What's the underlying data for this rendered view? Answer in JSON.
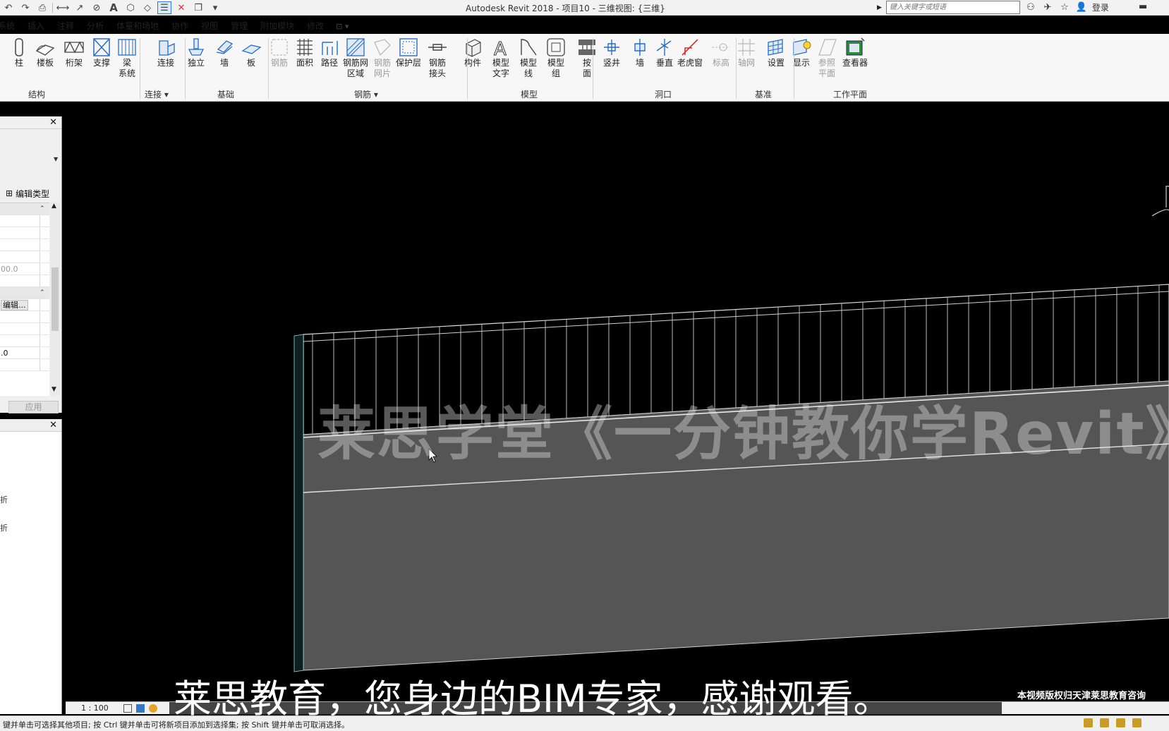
{
  "window": {
    "title": "Autodesk Revit 2018 -     项目10 - 三维视图: {三维}",
    "search_placeholder": "键入关键字或短语",
    "login_label": "登录",
    "minimize_label": "▬"
  },
  "tabs": [
    "系统",
    "插入",
    "注释",
    "分析",
    "体量和场地",
    "协作",
    "视图",
    "管理",
    "附加模块",
    "修改"
  ],
  "tab_extra": "⊡ ▾",
  "ribbon": {
    "tools": [
      {
        "id": "column",
        "label": "柱",
        "dim": false,
        "icon": "column-icon"
      },
      {
        "id": "floor",
        "label": "楼板",
        "dim": false,
        "icon": "floor-icon"
      },
      {
        "id": "truss",
        "label": "桁架",
        "dim": false,
        "icon": "truss-icon"
      },
      {
        "id": "brace",
        "label": "支撑",
        "dim": false,
        "icon": "brace-icon"
      },
      {
        "id": "beam-system",
        "label": "梁\n系统",
        "dim": false,
        "icon": "beam-system-icon"
      },
      {
        "id": "connection",
        "label": "连接",
        "dim": false,
        "icon": "connection-icon"
      },
      {
        "id": "isolated",
        "label": "独立",
        "dim": false,
        "icon": "isolated-foundation-icon"
      },
      {
        "id": "wall-foundation",
        "label": "墙",
        "dim": false,
        "icon": "wall-foundation-icon"
      },
      {
        "id": "slab",
        "label": "板",
        "dim": false,
        "icon": "slab-icon"
      },
      {
        "id": "rebar",
        "label": "钢筋",
        "dim": true,
        "icon": "rebar-icon"
      },
      {
        "id": "area",
        "label": "面积",
        "dim": false,
        "icon": "area-rebar-icon"
      },
      {
        "id": "path",
        "label": "路径",
        "dim": false,
        "icon": "path-rebar-icon"
      },
      {
        "id": "fabric-area",
        "label": "钢筋网\n区域",
        "dim": false,
        "icon": "fabric-area-icon"
      },
      {
        "id": "fabric-sheet",
        "label": "钢筋\n网片",
        "dim": true,
        "icon": "fabric-sheet-icon"
      },
      {
        "id": "cover",
        "label": "保护层",
        "dim": false,
        "icon": "cover-icon"
      },
      {
        "id": "coupler",
        "label": "钢筋\n接头",
        "dim": false,
        "icon": "coupler-icon"
      },
      {
        "id": "component",
        "label": "构件",
        "dim": false,
        "icon": "component-icon"
      },
      {
        "id": "model-text",
        "label": "模型\n文字",
        "dim": false,
        "icon": "model-text-icon"
      },
      {
        "id": "model-line",
        "label": "模型\n线",
        "dim": false,
        "icon": "model-line-icon"
      },
      {
        "id": "model-group",
        "label": "模型\n组",
        "dim": false,
        "icon": "model-group-icon"
      },
      {
        "id": "by-face",
        "label": "按\n面",
        "dim": false,
        "icon": "by-face-icon"
      },
      {
        "id": "shaft",
        "label": "竖井",
        "dim": false,
        "icon": "shaft-icon"
      },
      {
        "id": "wall-opening",
        "label": "墙",
        "dim": false,
        "icon": "wall-opening-icon"
      },
      {
        "id": "vertical",
        "label": "垂直",
        "dim": false,
        "icon": "vertical-opening-icon"
      },
      {
        "id": "dormer",
        "label": "老虎窗",
        "dim": false,
        "icon": "dormer-icon"
      },
      {
        "id": "level",
        "label": "标高",
        "dim": true,
        "icon": "level-icon"
      },
      {
        "id": "grid",
        "label": "轴网",
        "dim": true,
        "icon": "grid-icon"
      },
      {
        "id": "set",
        "label": "设置",
        "dim": false,
        "icon": "workplane-set-icon"
      },
      {
        "id": "show",
        "label": "显示",
        "dim": false,
        "icon": "workplane-show-icon"
      },
      {
        "id": "ref-plane",
        "label": "参照\n平面",
        "dim": true,
        "icon": "ref-plane-icon"
      },
      {
        "id": "viewer",
        "label": "查看器",
        "dim": false,
        "icon": "viewer-icon"
      }
    ],
    "panels": [
      "结构",
      "连接 ▾",
      "基础",
      "钢筋 ▾",
      "模型",
      "洞口",
      "基准",
      "工作平面"
    ]
  },
  "properties": {
    "edit_type_label": "编辑类型",
    "value_row": "00.0",
    "edit_button": "编辑...",
    "value_row2": ".0",
    "apply_label": "应用"
  },
  "browser": {
    "items": [
      "折",
      "折"
    ]
  },
  "viewport": {
    "watermark": "莱思学堂《一分钟教你学Revit》",
    "subtitle": "莱思教育，您身边的BIM专家，感谢观看。",
    "copyright": "本视频版权归天津莱思教育咨询"
  },
  "viewbar": {
    "scale": "1 : 100"
  },
  "status": {
    "text": "键并单击可选择其他项目; 按 Ctrl 键并单击可将新项目添加到选择集; 按 Shift 键并单击可取消选择。"
  },
  "colors": {
    "ribbon_bg": "#f7f7f7",
    "viewport_bg": "#000000",
    "wall_face": "#555555",
    "icon_blue": "#2a6db5"
  }
}
